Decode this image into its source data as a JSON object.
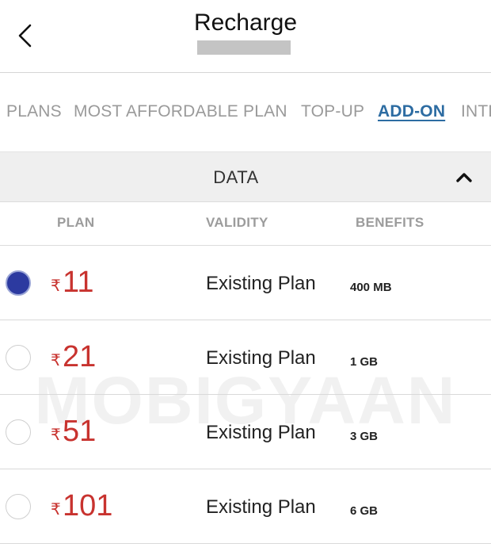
{
  "header": {
    "title": "Recharge",
    "back_icon": "chevron-left-icon"
  },
  "tabs": [
    {
      "label": "PLANS",
      "active": false
    },
    {
      "label": "MOST AFFORDABLE PLAN",
      "active": false
    },
    {
      "label": "TOP-UP",
      "active": false
    },
    {
      "label": "ADD-ON",
      "active": true
    },
    {
      "label": "INTE",
      "active": false
    }
  ],
  "section": {
    "title": "DATA",
    "caret_icon": "chevron-up-icon"
  },
  "columns": {
    "plan": "PLAN",
    "validity": "VALIDITY",
    "benefits": "BENEFITS"
  },
  "plans": [
    {
      "currency": "₹",
      "amount": "11",
      "validity": "Existing Plan",
      "benefit": "400 MB",
      "selected": true
    },
    {
      "currency": "₹",
      "amount": "21",
      "validity": "Existing Plan",
      "benefit": "1 GB",
      "selected": false
    },
    {
      "currency": "₹",
      "amount": "51",
      "validity": "Existing Plan",
      "benefit": "3 GB",
      "selected": false
    },
    {
      "currency": "₹",
      "amount": "101",
      "validity": "Existing Plan",
      "benefit": "6 GB",
      "selected": false
    }
  ],
  "watermark": "MOBIGYAAN",
  "colors": {
    "accent_tab": "#2d6ca2",
    "price": "#c8332f",
    "radio_selected": "#2c3aa0"
  }
}
